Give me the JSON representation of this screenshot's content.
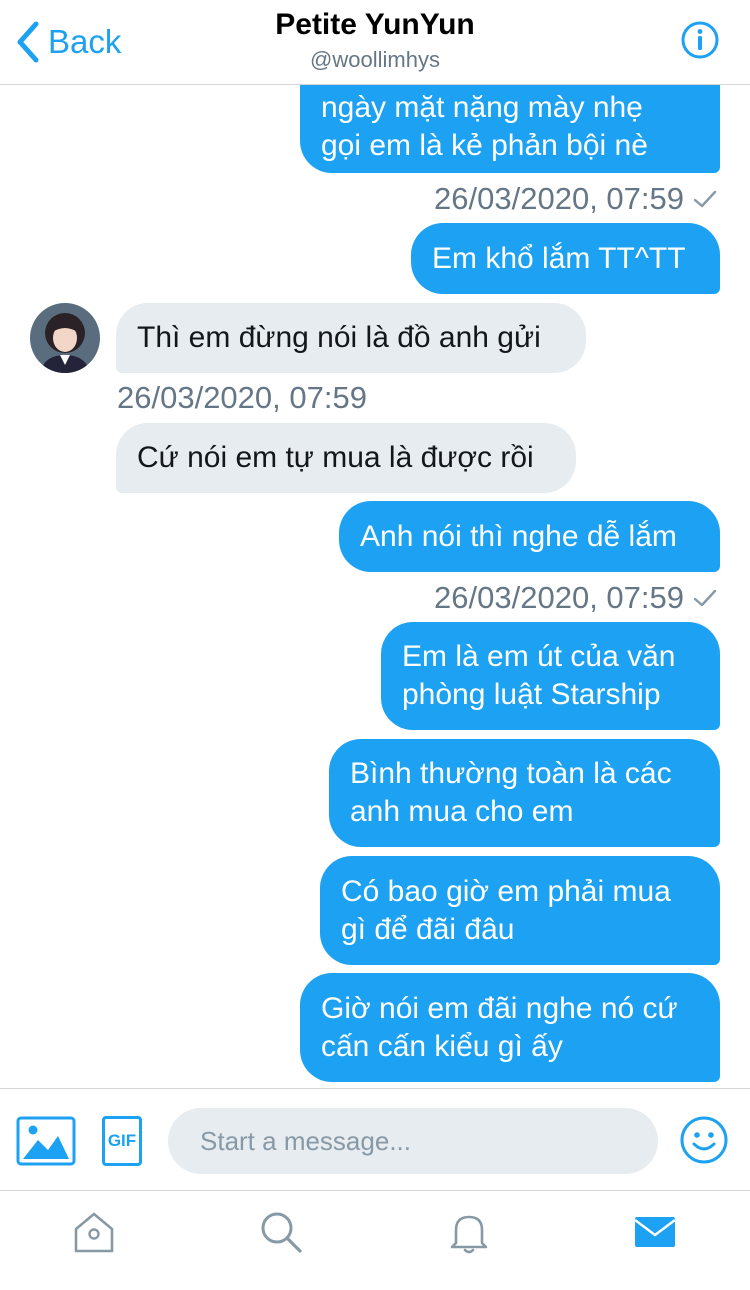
{
  "header": {
    "back_label": "Back",
    "title": "Petite YunYun",
    "handle": "@woollimhys"
  },
  "messages": [
    {
      "from": "me",
      "lines": [
        "ngày mặt nặng mày nhẹ",
        "gọi em là kẻ phản bội nè"
      ]
    },
    {
      "from": "me",
      "timestamp": "26/03/2020, 07:59"
    },
    {
      "from": "me",
      "lines": [
        "Em khổ lắm TT^TT"
      ]
    },
    {
      "from": "them",
      "lines": [
        "Thì em đừng nói là đồ anh gửi"
      ]
    },
    {
      "from": "them",
      "timestamp": "26/03/2020, 07:59"
    },
    {
      "from": "them",
      "lines": [
        "Cứ nói em tự mua là được rồi"
      ]
    },
    {
      "from": "me",
      "lines": [
        "Anh nói thì nghe dễ lắm"
      ]
    },
    {
      "from": "me",
      "timestamp": "26/03/2020, 07:59"
    },
    {
      "from": "me",
      "lines": [
        "Em là em út của văn",
        "phòng luật Starship"
      ]
    },
    {
      "from": "me",
      "lines": [
        "Bình thường toàn là các",
        "anh mua cho em"
      ]
    },
    {
      "from": "me",
      "lines": [
        "Có bao giờ em phải mua",
        "gì để đãi đâu"
      ]
    },
    {
      "from": "me",
      "lines": [
        "Giờ nói em đãi nghe nó cứ",
        "cấn cấn kiểu gì ấy"
      ]
    }
  ],
  "composer": {
    "placeholder": "Start a message...",
    "gif_label": "GIF"
  },
  "tabs": [
    {
      "icon": "home-icon",
      "active": false
    },
    {
      "icon": "search-icon",
      "active": false
    },
    {
      "icon": "bell-icon",
      "active": false
    },
    {
      "icon": "mail-icon",
      "active": true
    }
  ],
  "colors": {
    "accent": "#1da1f2",
    "incoming_bubble": "#e6ecf0",
    "muted_text": "#657786",
    "inactive_icon": "#8899a6"
  }
}
